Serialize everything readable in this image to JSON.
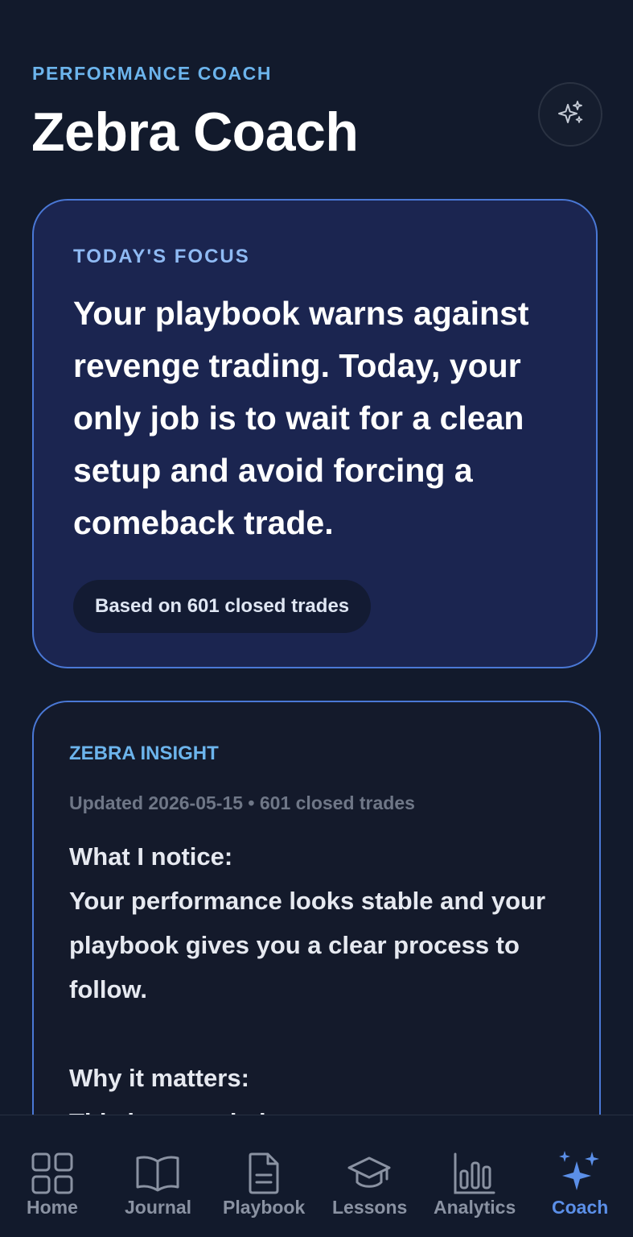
{
  "header": {
    "eyebrow": "PERFORMANCE COACH",
    "title": "Zebra Coach",
    "action_icon": "sparkles-icon"
  },
  "focus_card": {
    "label": "TODAY'S FOCUS",
    "text": "Your playbook warns against revenge trading. Today, your only job is to wait for a clean setup and avoid forcing a comeback trade.",
    "badge": "Based on 601 closed trades"
  },
  "insight_card": {
    "label": "ZEBRA INSIGHT",
    "meta": "Updated 2026-05-15 • 601 closed trades",
    "body": "What I notice:\nYour performance looks stable and your playbook gives you a clear process to follow.\n\nWhy it matters:\nThis is a good place to st"
  },
  "nav": {
    "items": [
      {
        "label": "Home",
        "icon": "grid-icon",
        "active": false
      },
      {
        "label": "Journal",
        "icon": "book-icon",
        "active": false
      },
      {
        "label": "Playbook",
        "icon": "document-icon",
        "active": false
      },
      {
        "label": "Lessons",
        "icon": "graduation-cap-icon",
        "active": false
      },
      {
        "label": "Analytics",
        "icon": "bar-chart-icon",
        "active": false
      },
      {
        "label": "Coach",
        "icon": "sparkles-icon",
        "active": true
      }
    ]
  },
  "colors": {
    "background": "#121a2c",
    "accent": "#5b8fe8",
    "eyebrow": "#6cb4ec",
    "focus_card_bg": "#1b2550",
    "card_border": "#4a78d6"
  }
}
